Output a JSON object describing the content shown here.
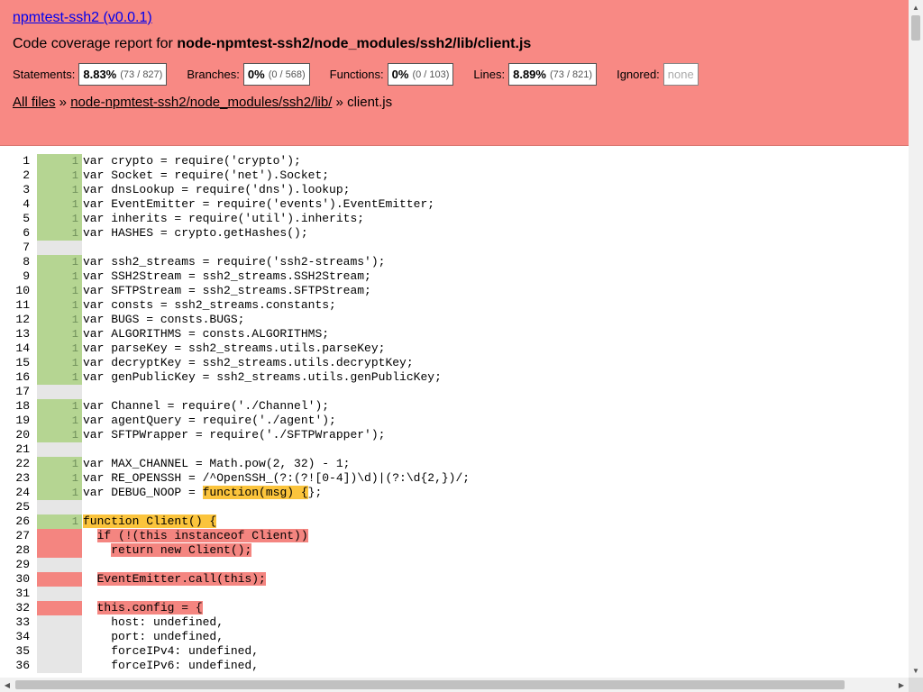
{
  "header": {
    "title": "npmtest-ssh2 (v0.0.1)",
    "subtitle_prefix": "Code coverage report for ",
    "subtitle_path": "node-npmtest-ssh2/node_modules/ssh2/lib/client.js",
    "stats": {
      "statements": {
        "label": "Statements:",
        "pct": "8.83%",
        "frac": "(73 / 827)"
      },
      "branches": {
        "label": "Branches:",
        "pct": "0%",
        "frac": "(0 / 568)"
      },
      "functions": {
        "label": "Functions:",
        "pct": "0%",
        "frac": "(0 / 103)"
      },
      "lines": {
        "label": "Lines:",
        "pct": "8.89%",
        "frac": "(73 / 821)"
      },
      "ignored": {
        "label": "Ignored:",
        "value": "none"
      }
    },
    "breadcrumb": {
      "all_files": "All files",
      "sep1": " » ",
      "dir": "node-npmtest-ssh2/node_modules/ssh2/lib/",
      "sep2": " » ",
      "file": "client.js"
    }
  },
  "code_lines": [
    {
      "n": "1",
      "hits": "1",
      "cov": "cov",
      "segments": [
        {
          "t": "var crypto = require('crypto');"
        }
      ]
    },
    {
      "n": "2",
      "hits": "1",
      "cov": "cov",
      "segments": [
        {
          "t": "var Socket = require('net').Socket;"
        }
      ]
    },
    {
      "n": "3",
      "hits": "1",
      "cov": "cov",
      "segments": [
        {
          "t": "var dnsLookup = require('dns').lookup;"
        }
      ]
    },
    {
      "n": "4",
      "hits": "1",
      "cov": "cov",
      "segments": [
        {
          "t": "var EventEmitter = require('events').EventEmitter;"
        }
      ]
    },
    {
      "n": "5",
      "hits": "1",
      "cov": "cov",
      "segments": [
        {
          "t": "var inherits = require('util').inherits;"
        }
      ]
    },
    {
      "n": "6",
      "hits": "1",
      "cov": "cov",
      "segments": [
        {
          "t": "var HASHES = crypto.getHashes();"
        }
      ]
    },
    {
      "n": "7",
      "hits": "",
      "cov": "none",
      "segments": [
        {
          "t": ""
        }
      ]
    },
    {
      "n": "8",
      "hits": "1",
      "cov": "cov",
      "segments": [
        {
          "t": "var ssh2_streams = require('ssh2-streams');"
        }
      ]
    },
    {
      "n": "9",
      "hits": "1",
      "cov": "cov",
      "segments": [
        {
          "t": "var SSH2Stream = ssh2_streams.SSH2Stream;"
        }
      ]
    },
    {
      "n": "10",
      "hits": "1",
      "cov": "cov",
      "segments": [
        {
          "t": "var SFTPStream = ssh2_streams.SFTPStream;"
        }
      ]
    },
    {
      "n": "11",
      "hits": "1",
      "cov": "cov",
      "segments": [
        {
          "t": "var consts = ssh2_streams.constants;"
        }
      ]
    },
    {
      "n": "12",
      "hits": "1",
      "cov": "cov",
      "segments": [
        {
          "t": "var BUGS = consts.BUGS;"
        }
      ]
    },
    {
      "n": "13",
      "hits": "1",
      "cov": "cov",
      "segments": [
        {
          "t": "var ALGORITHMS = consts.ALGORITHMS;"
        }
      ]
    },
    {
      "n": "14",
      "hits": "1",
      "cov": "cov",
      "segments": [
        {
          "t": "var parseKey = ssh2_streams.utils.parseKey;"
        }
      ]
    },
    {
      "n": "15",
      "hits": "1",
      "cov": "cov",
      "segments": [
        {
          "t": "var decryptKey = ssh2_streams.utils.decryptKey;"
        }
      ]
    },
    {
      "n": "16",
      "hits": "1",
      "cov": "cov",
      "segments": [
        {
          "t": "var genPublicKey = ssh2_streams.utils.genPublicKey;"
        }
      ]
    },
    {
      "n": "17",
      "hits": "",
      "cov": "none",
      "segments": [
        {
          "t": ""
        }
      ]
    },
    {
      "n": "18",
      "hits": "1",
      "cov": "cov",
      "segments": [
        {
          "t": "var Channel = require('./Channel');"
        }
      ]
    },
    {
      "n": "19",
      "hits": "1",
      "cov": "cov",
      "segments": [
        {
          "t": "var agentQuery = require('./agent');"
        }
      ]
    },
    {
      "n": "20",
      "hits": "1",
      "cov": "cov",
      "segments": [
        {
          "t": "var SFTPWrapper = require('./SFTPWrapper');"
        }
      ]
    },
    {
      "n": "21",
      "hits": "",
      "cov": "none",
      "segments": [
        {
          "t": ""
        }
      ]
    },
    {
      "n": "22",
      "hits": "1",
      "cov": "cov",
      "segments": [
        {
          "t": "var MAX_CHANNEL = Math.pow(2, 32) - 1;"
        }
      ]
    },
    {
      "n": "23",
      "hits": "1",
      "cov": "cov",
      "segments": [
        {
          "t": "var RE_OPENSSH = /^OpenSSH_(?:(?![0-4])\\d)|(?:\\d{2,})/;"
        }
      ]
    },
    {
      "n": "24",
      "hits": "1",
      "cov": "cov",
      "segments": [
        {
          "t": "var DEBUG_NOOP = "
        },
        {
          "t": "function(msg) {",
          "hl": "yellow"
        },
        {
          "t": "};"
        }
      ]
    },
    {
      "n": "25",
      "hits": "",
      "cov": "none",
      "segments": [
        {
          "t": ""
        }
      ]
    },
    {
      "n": "26",
      "hits": "1",
      "cov": "cov",
      "segments": [
        {
          "t": "function Client() {",
          "hl": "yellow"
        }
      ]
    },
    {
      "n": "27",
      "hits": "",
      "cov": "nocov",
      "segments": [
        {
          "t": "  "
        },
        {
          "t": "if (!(this instanceof Client))",
          "hl": "red"
        }
      ]
    },
    {
      "n": "28",
      "hits": "",
      "cov": "nocov",
      "segments": [
        {
          "t": "    "
        },
        {
          "t": "return new Client();",
          "hl": "red"
        }
      ]
    },
    {
      "n": "29",
      "hits": "",
      "cov": "none",
      "segments": [
        {
          "t": ""
        }
      ]
    },
    {
      "n": "30",
      "hits": "",
      "cov": "nocov",
      "segments": [
        {
          "t": "  "
        },
        {
          "t": "EventEmitter.call(this);",
          "hl": "red"
        }
      ]
    },
    {
      "n": "31",
      "hits": "",
      "cov": "none",
      "segments": [
        {
          "t": ""
        }
      ]
    },
    {
      "n": "32",
      "hits": "",
      "cov": "nocov",
      "segments": [
        {
          "t": "  "
        },
        {
          "t": "this.config = {",
          "hl": "red"
        }
      ]
    },
    {
      "n": "33",
      "hits": "",
      "cov": "none",
      "segments": [
        {
          "t": "    host: undefined,"
        }
      ]
    },
    {
      "n": "34",
      "hits": "",
      "cov": "none",
      "segments": [
        {
          "t": "    port: undefined,"
        }
      ]
    },
    {
      "n": "35",
      "hits": "",
      "cov": "none",
      "segments": [
        {
          "t": "    forceIPv4: undefined,"
        }
      ]
    },
    {
      "n": "36",
      "hits": "",
      "cov": "none",
      "segments": [
        {
          "t": "    forceIPv6: undefined,"
        }
      ]
    }
  ]
}
